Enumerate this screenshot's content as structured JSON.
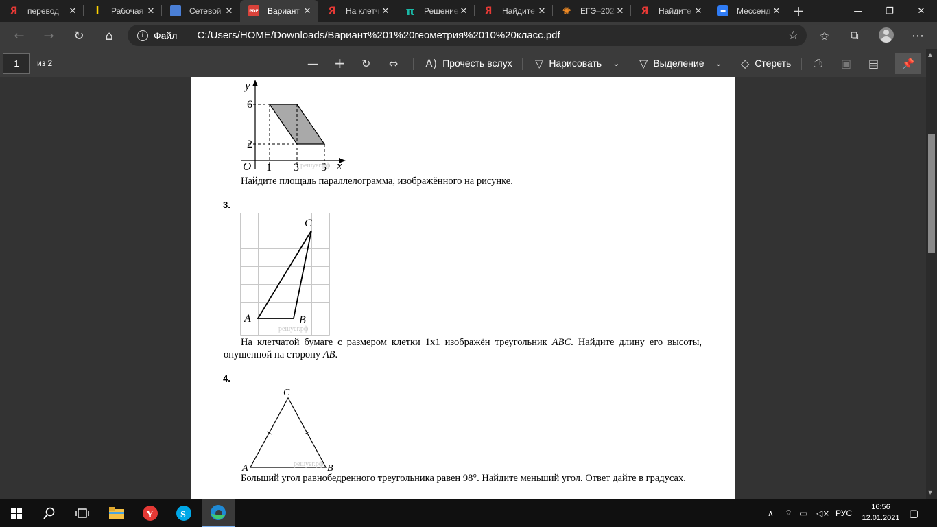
{
  "tabs": [
    {
      "title": "перевод",
      "icon": "yandex-icon",
      "active": false
    },
    {
      "title": "Рабочая",
      "icon": "info-icon",
      "active": false
    },
    {
      "title": "Сетевой",
      "icon": "grid-icon",
      "active": false
    },
    {
      "title": "Вариант",
      "icon": "pdf-icon",
      "active": true
    },
    {
      "title": "На клетч",
      "icon": "yandex-icon",
      "active": false
    },
    {
      "title": "Решение",
      "icon": "pi-icon",
      "active": false
    },
    {
      "title": "Найдите",
      "icon": "yandex-icon",
      "active": false
    },
    {
      "title": "ЕГЭ–202",
      "icon": "sun-icon",
      "active": false
    },
    {
      "title": "Найдите",
      "icon": "yandex-icon",
      "active": false
    },
    {
      "title": "Мессенд",
      "icon": "chat-icon",
      "active": false
    }
  ],
  "address": {
    "scheme": "Файл",
    "url": "C:/Users/HOME/Downloads/Вариант%201%20геометрия%2010%20класс.pdf"
  },
  "pdf_toolbar": {
    "page": "1",
    "total": "из 2",
    "read_aloud": "Прочесть вслух",
    "draw": "Нарисовать",
    "highlight": "Выделение",
    "erase": "Стереть"
  },
  "document": {
    "fig2": {
      "y_axis": "y",
      "x_axis": "x",
      "origin": "O",
      "y_ticks": [
        "6",
        "2"
      ],
      "x_ticks": [
        "1",
        "3",
        "5"
      ],
      "watermark": "решуег.рф"
    },
    "q2_text": "Найдите площадь параллелограмма, изображённого на рисунке.",
    "q3_num": "3.",
    "fig3": {
      "a": "A",
      "b": "B",
      "c": "C",
      "watermark": "решуег.рф"
    },
    "q3_text_1": "На клетчатой бумаге с размером клетки 1х1 изображён треугольник ",
    "q3_abc": "ABC",
    "q3_text_2": ". Найдите длину его высоты, опущенной на сторону ",
    "q3_ab": "AB",
    "q3_text_3": ".",
    "q4_num": "4.",
    "fig4": {
      "a": "A",
      "b": "B",
      "c": "C",
      "watermark": "решуег.рф"
    },
    "q4_text": "Больший угол равнобедренного треугольника равен 98°. Найдите меньший угол. Ответ дайте в градусах."
  },
  "taskbar": {
    "lang": "РУС",
    "time": "16:56",
    "date": "12.01.2021"
  }
}
